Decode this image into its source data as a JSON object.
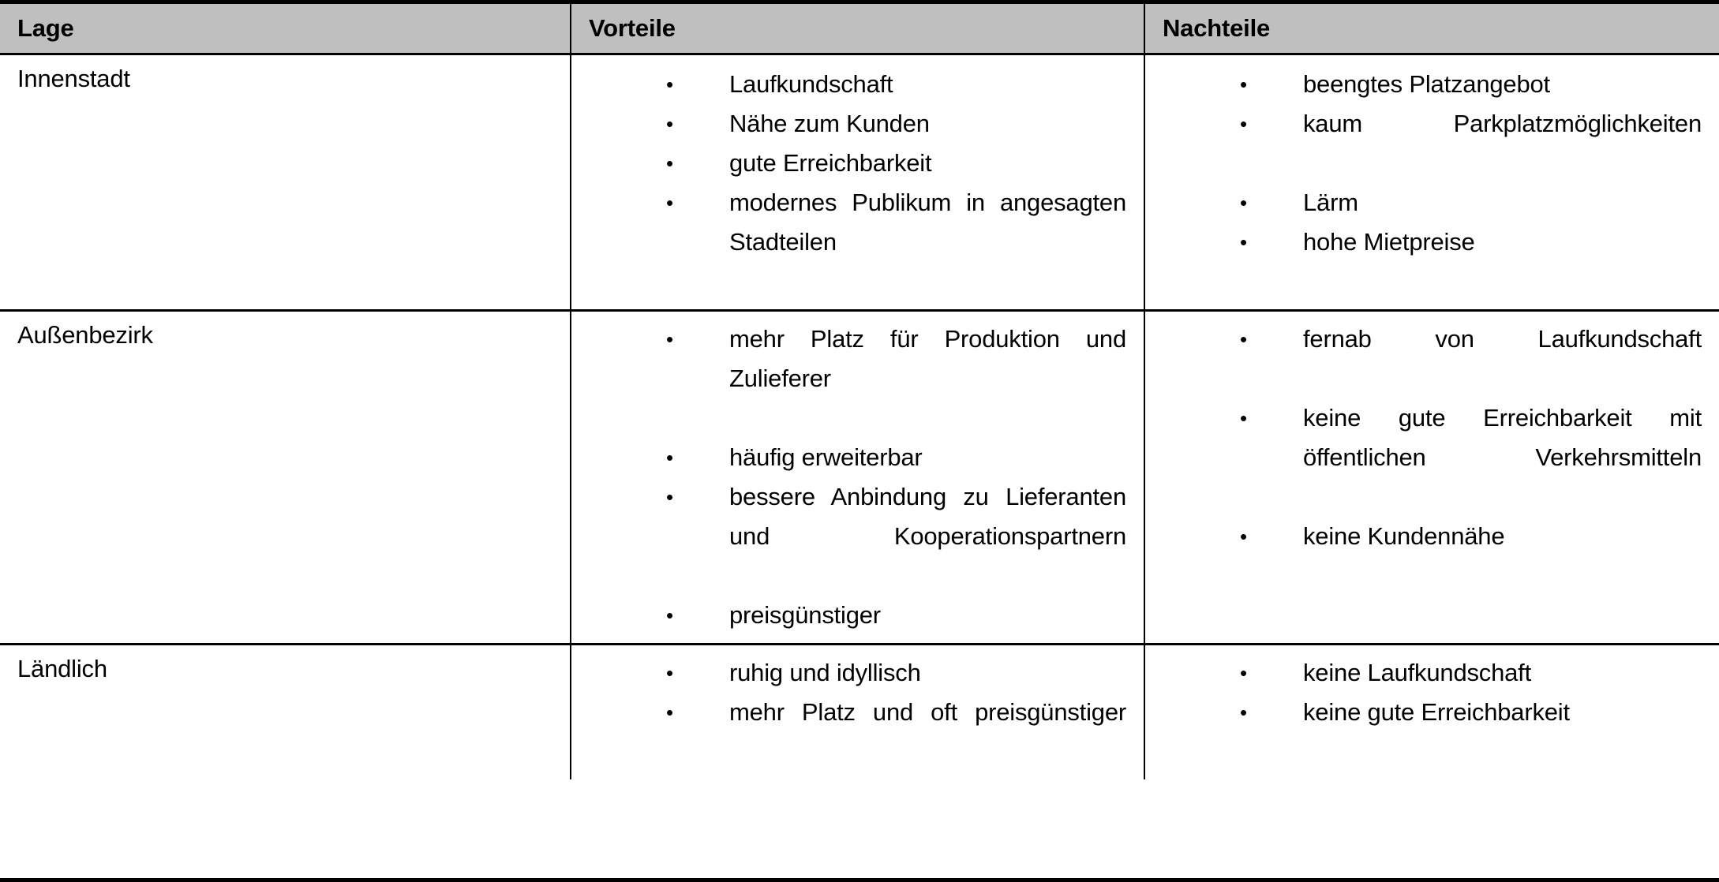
{
  "table": {
    "columns": [
      {
        "key": "lage",
        "label": "Lage"
      },
      {
        "key": "vorteile",
        "label": "Vorteile"
      },
      {
        "key": "nachteile",
        "label": "Nachteile"
      }
    ],
    "header_background": "#BFBFBF",
    "border_color": "#000000",
    "text_color": "#000000",
    "bullet_glyph": "•",
    "rows": [
      {
        "lage": "Innenstadt",
        "vorteile": [
          {
            "text": "Laufkundschaft",
            "justified": false
          },
          {
            "text": "Nähe zum Kunden",
            "justified": false
          },
          {
            "text": "gute Erreichbarkeit",
            "justified": false
          },
          {
            "text": "modernes Publikum in angesagten Stadteilen",
            "justified": true
          }
        ],
        "nachteile": [
          {
            "text": "beengtes Platzangebot",
            "justified": false
          },
          {
            "text": "kaum Parkplatzmöglichkeiten",
            "justified": true
          },
          {
            "text": "Lärm",
            "justified": false
          },
          {
            "text": "hohe Mietpreise",
            "justified": false
          }
        ]
      },
      {
        "lage": "Außenbezirk",
        "vorteile": [
          {
            "text": "mehr Platz für Produktion und Zulieferer",
            "justified": true
          },
          {
            "text": "häufig erweiterbar",
            "justified": false
          },
          {
            "text": "bessere Anbindung zu Lieferanten und Kooperationspartnern",
            "justified": true
          },
          {
            "text": "preisgünstiger",
            "justified": false
          }
        ],
        "nachteile": [
          {
            "text": "fernab von Laufkundschaft",
            "justified": true
          },
          {
            "text": "keine gute Erreichbarkeit mit öffentlichen Verkehrsmitteln",
            "justified": true
          },
          {
            "text": "keine Kundennähe",
            "justified": false
          }
        ]
      },
      {
        "lage": "Ländlich",
        "vorteile": [
          {
            "text": "ruhig und idyllisch",
            "justified": false
          },
          {
            "text": "mehr Platz und oft preisgünstiger",
            "justified": true
          }
        ],
        "nachteile": [
          {
            "text": "keine Laufkundschaft",
            "justified": false
          },
          {
            "text": "keine gute Erreichbarkeit",
            "justified": false
          }
        ]
      }
    ]
  }
}
